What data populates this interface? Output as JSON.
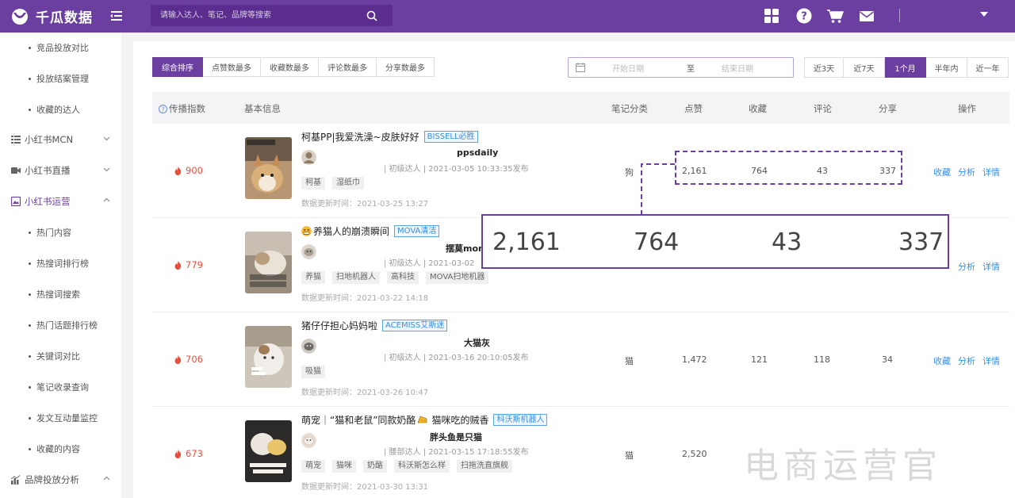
{
  "brand": {
    "name": "千瓜数据",
    "accent": "#6b3fa0"
  },
  "search": {
    "placeholder": "请输入达人、笔记、品牌等搜索"
  },
  "header_icons": [
    "grid-icon",
    "help-icon",
    "cart-icon",
    "mail-icon"
  ],
  "sidebar": {
    "items": [
      {
        "type": "sub",
        "label": "竞品投放对比"
      },
      {
        "type": "sub",
        "label": "投放结案管理"
      },
      {
        "type": "sub",
        "label": "收藏的达人"
      },
      {
        "type": "group",
        "label": "小红书MCN",
        "icon": "list-icon",
        "expanded": false
      },
      {
        "type": "group",
        "label": "小红书直播",
        "icon": "video-icon",
        "expanded": false
      },
      {
        "type": "group",
        "label": "小红书运营",
        "icon": "image-icon",
        "expanded": true
      },
      {
        "type": "sub",
        "label": "热门内容"
      },
      {
        "type": "sub",
        "label": "热搜词排行榜"
      },
      {
        "type": "sub",
        "label": "热搜词搜索"
      },
      {
        "type": "sub",
        "label": "热门话题排行榜"
      },
      {
        "type": "sub",
        "label": "关键词对比"
      },
      {
        "type": "sub",
        "label": "笔记收录查询"
      },
      {
        "type": "sub",
        "label": "发文互动量监控"
      },
      {
        "type": "sub",
        "label": "收藏的内容"
      },
      {
        "type": "group",
        "label": "品牌投放分析",
        "icon": "chart-icon",
        "expanded": true
      }
    ]
  },
  "sort_tabs": [
    "综合排序",
    "点赞数最多",
    "收藏数最多",
    "评论数最多",
    "分享数最多"
  ],
  "sort_active": 0,
  "date_range": {
    "start_placeholder": "开始日期",
    "separator": "至",
    "end_placeholder": "结束日期"
  },
  "period_tabs": [
    "近3天",
    "近7天",
    "1个月",
    "半年内",
    "近一年"
  ],
  "period_active": 2,
  "table": {
    "headers": {
      "index": "传播指数",
      "info": "基本信息",
      "category": "笔记分类",
      "likes": "点赞",
      "favorites": "收藏",
      "comments": "评论",
      "shares": "分享",
      "actions": "操作"
    },
    "action_labels": {
      "fav": "收藏",
      "analyze": "分析",
      "detail": "详情"
    },
    "rows": [
      {
        "hot": "900",
        "title": "柯基PP|我爱洗澡~皮肤好好",
        "brand": "BISSELL必胜",
        "emoji": "",
        "author": "ppsdaily",
        "meta": "| 初级达人  | 2021-03-05 10:33:35发布",
        "tags": [
          "柯基",
          "湿纸巾"
        ],
        "updated": "数据更新时间：2021-03-25 13:27",
        "category": "狗",
        "likes": "2,161",
        "favorites": "764",
        "comments": "43",
        "shares": "337"
      },
      {
        "hot": "779",
        "title": "养猫人的崩溃瞬间",
        "brand": "MOVA清洁",
        "emoji": "grimace-emoji",
        "author": "摆莫momom",
        "meta": "| 初级达人  | 2021-03-02",
        "tags": [
          "养猫",
          "扫地机器人",
          "高科技",
          "MOVA扫地机器"
        ],
        "updated": "数据更新时间：2021-03-22 14:18",
        "category": "",
        "likes": "",
        "favorites": "",
        "comments": "",
        "shares": ""
      },
      {
        "hot": "706",
        "title": "猪仔仔担心妈妈啦",
        "brand": "ACEMISS艾斯迷",
        "emoji": "",
        "author": "大猫灰",
        "meta": "| 初级达人  | 2021-03-16 20:10:05发布",
        "tags": [
          "吸猫"
        ],
        "updated": "数据更新时间：2021-03-26 10:47",
        "category": "猫",
        "likes": "1,472",
        "favorites": "121",
        "comments": "118",
        "shares": "34"
      },
      {
        "hot": "673",
        "title": "萌宠｜“猫和老鼠”同款奶酪",
        "title_suffix": "猫咪吃的贼香",
        "brand": "科沃斯机器人",
        "emoji": "",
        "author": "胖头鱼是只猫",
        "meta": "| 腰部达人  | 2021-03-15 17:18:55发布",
        "tags": [
          "萌宠",
          "猫咪",
          "奶酪",
          "科沃斯怎么样",
          "扫拖洗直旗舰"
        ],
        "updated": "数据更新时间：2021-03-30 13:31",
        "category": "猫",
        "likes": "2,520",
        "favorites": "",
        "comments": "",
        "shares": ""
      }
    ]
  },
  "callout": {
    "likes": "2,161",
    "favorites": "764",
    "comments": "43",
    "shares": "337"
  },
  "watermark": "电商运营官"
}
